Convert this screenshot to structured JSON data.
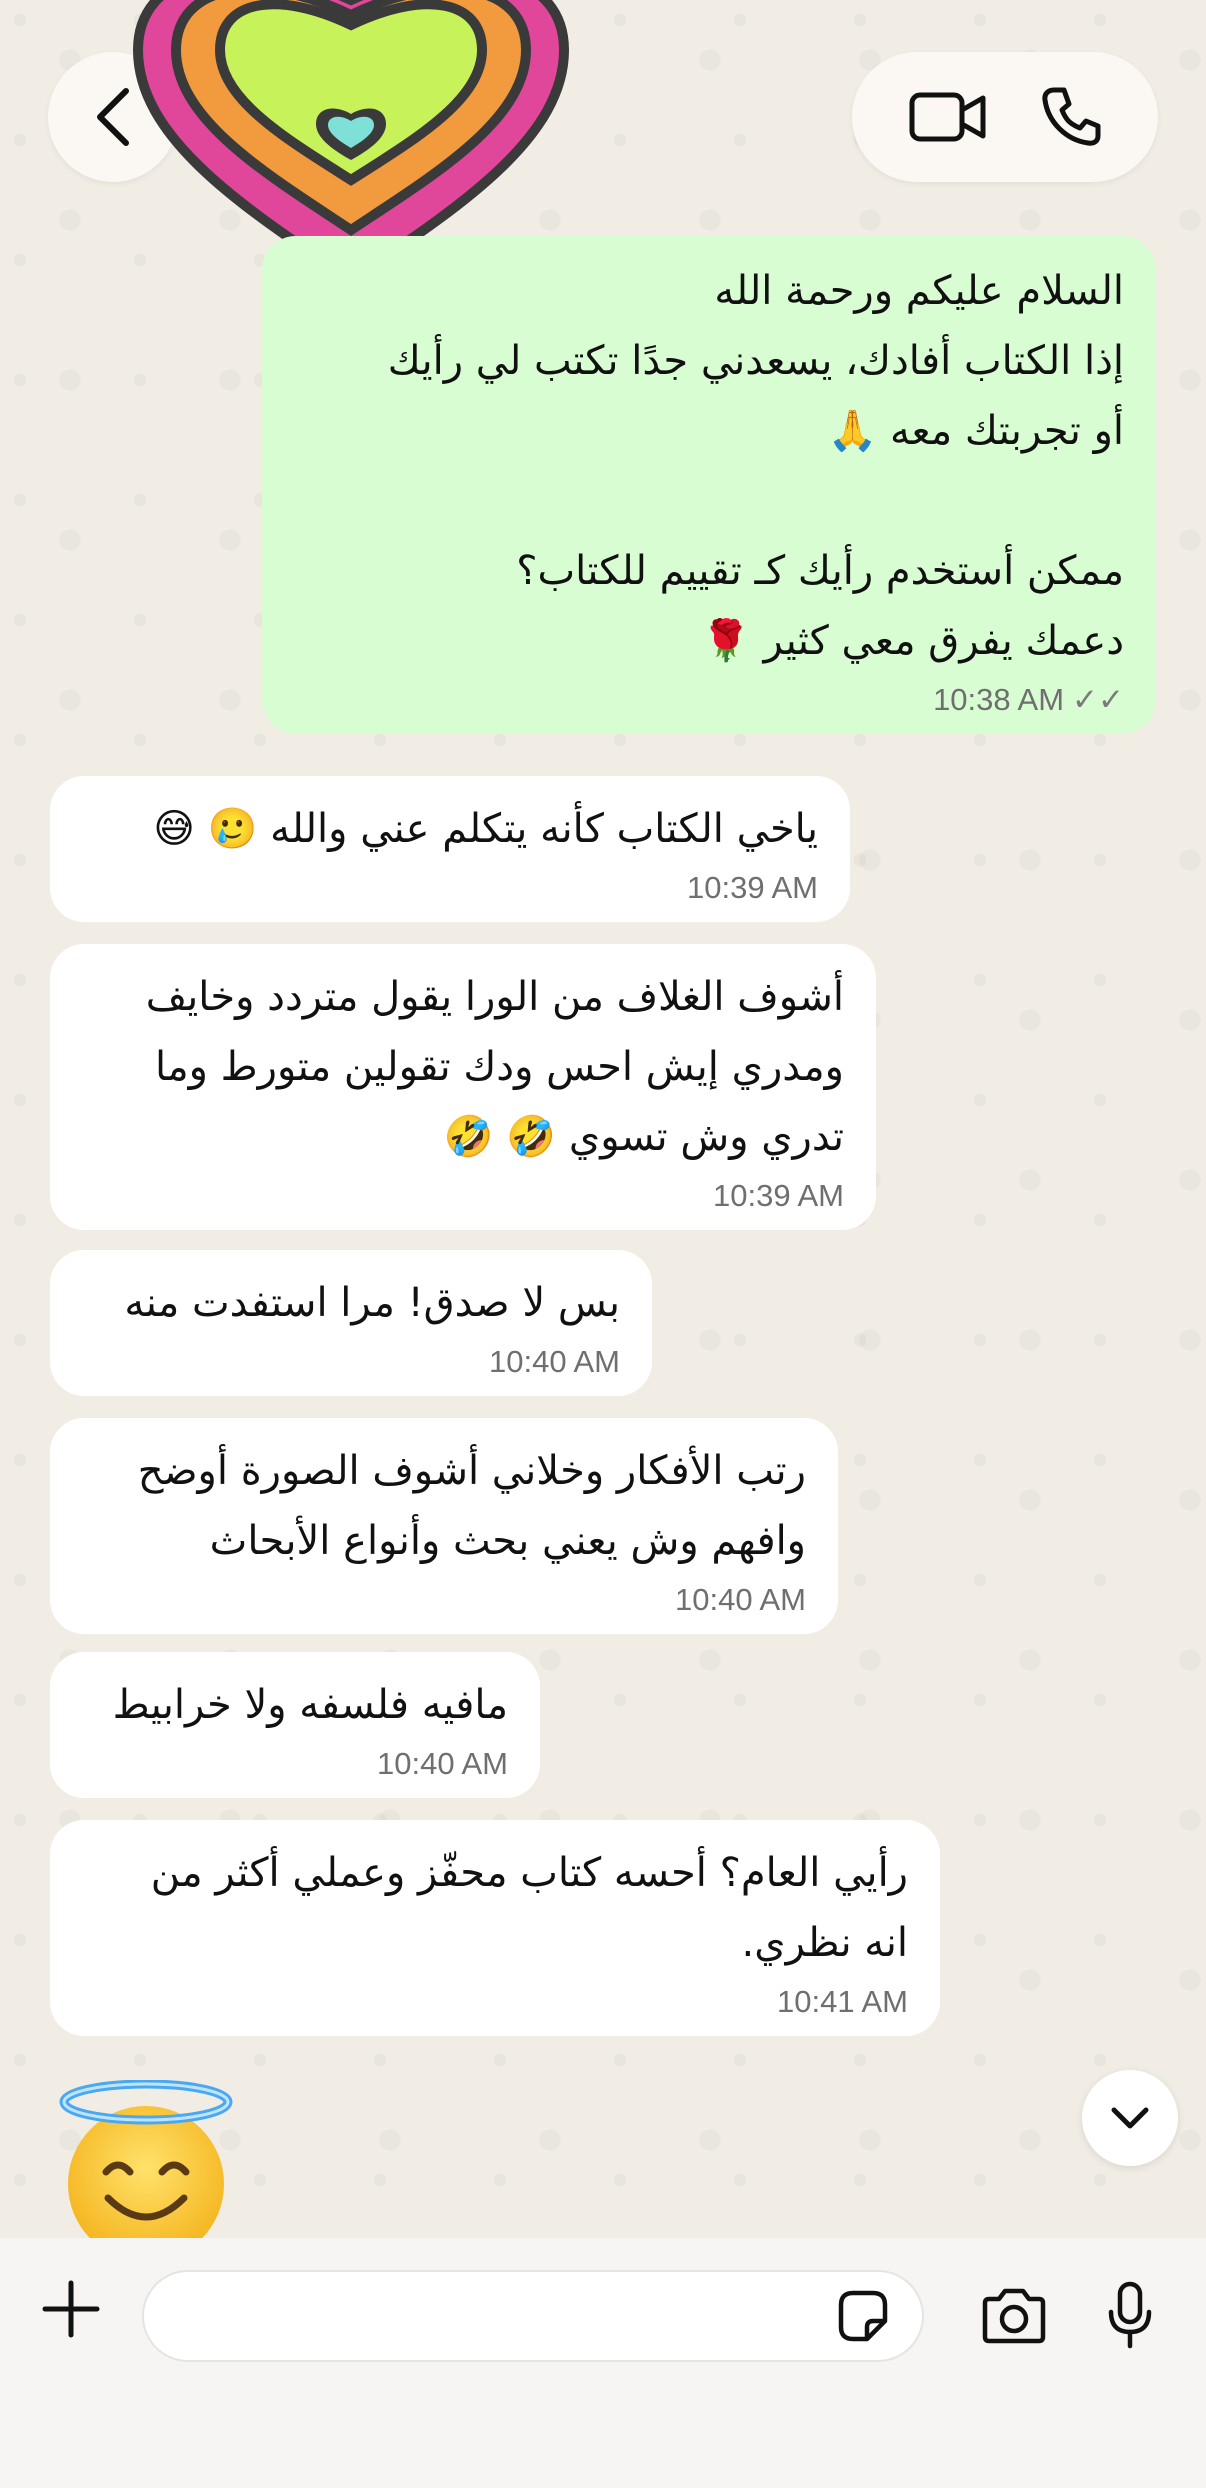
{
  "header": {
    "back_icon": "chevron-left-icon",
    "video_icon": "video-camera-icon",
    "phone_icon": "phone-icon",
    "avatar": "heart-avatar"
  },
  "messages": [
    {
      "direction": "outgoing",
      "lines": [
        "السلام عليكم ورحمة الله",
        "إذا الكتاب أفادك، يسعدني جدًا تكتب لي رأيك",
        "أو تجربتك معه 🙏",
        "",
        "ممكن أستخدم رأيك كـ تقييم للكتاب؟",
        "دعمك يفرق معي كثير 🌹"
      ],
      "time": "10:38 AM",
      "ticks": "✓✓"
    },
    {
      "direction": "incoming",
      "lines": [
        "ياخي الكتاب كأنه يتكلم عني والله 🥲 😅"
      ],
      "time": "10:39 AM"
    },
    {
      "direction": "incoming",
      "lines": [
        "أشوف الغلاف من الورا يقول متردد وخايف",
        "ومدري إيش احس ودك تقولين متورط وما",
        "تدري وش تسوي 🤣 🤣"
      ],
      "time": "10:39 AM"
    },
    {
      "direction": "incoming",
      "lines": [
        "بس لا صدق! مرا استفدت منه"
      ],
      "time": "10:40 AM"
    },
    {
      "direction": "incoming",
      "lines": [
        "رتب الأفكار وخلاني أشوف الصورة أوضح",
        "وافهم وش يعني بحث وأنواع الأبحاث"
      ],
      "time": "10:40 AM"
    },
    {
      "direction": "incoming",
      "lines": [
        "مافيه فلسفه ولا خرابيط"
      ],
      "time": "10:40 AM"
    },
    {
      "direction": "incoming",
      "lines": [
        "رأيي العام؟ أحسه كتاب محفّز وعملي أكثر من",
        "انه نظري."
      ],
      "time": "10:41 AM"
    }
  ],
  "sticker": {
    "emoji": "😇",
    "icon": "smiling-face-with-halo-icon"
  },
  "composer": {
    "input_value": "",
    "input_placeholder": "",
    "plus_icon": "plus-icon",
    "sticker_icon": "sticker-icon",
    "camera_icon": "camera-icon",
    "mic_icon": "microphone-icon"
  },
  "scroll_down_icon": "chevron-down-icon",
  "colors": {
    "background": "#efeae2",
    "incoming_bubble": "#ffffff",
    "outgoing_bubble": "#d9fdd3",
    "timestamp": "#6f6f6f"
  }
}
